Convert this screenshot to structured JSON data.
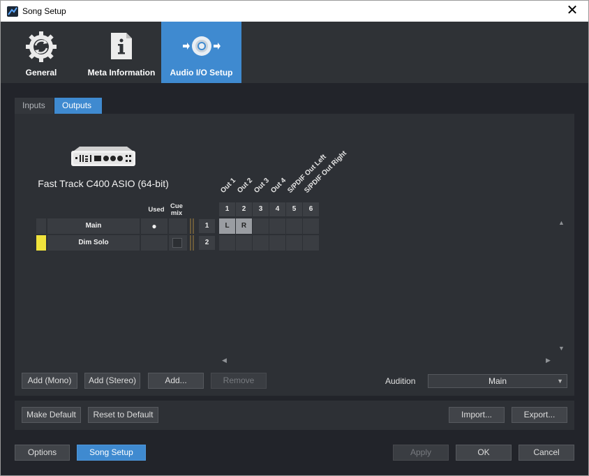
{
  "window": {
    "title": "Song Setup",
    "close_glyph": "✕"
  },
  "top_tabs": [
    {
      "label": "General",
      "icon": "gear-refresh-icon",
      "active": false
    },
    {
      "label": "Meta Information",
      "icon": "info-document-icon",
      "active": false
    },
    {
      "label": "Audio I/O Setup",
      "icon": "speaker-io-icon",
      "active": true
    }
  ],
  "sub_tabs": [
    {
      "label": "Inputs",
      "active": false
    },
    {
      "label": "Outputs",
      "active": true
    }
  ],
  "device": {
    "name": "Fast Track C400 ASIO (64-bit)"
  },
  "columns": {
    "used": "Used",
    "cue_mix": "Cue mix"
  },
  "channel_labels": [
    "Out 1",
    "Out 2",
    "Out 3",
    "Out 4",
    "S/PDIF Out Left",
    "S/PDIF Out Right"
  ],
  "channel_numbers": [
    "1",
    "2",
    "3",
    "4",
    "5",
    "6"
  ],
  "rows": [
    {
      "color": "#393c41",
      "name": "Main",
      "used": "●",
      "number": "1",
      "assign": [
        "L",
        "R",
        "",
        "",
        "",
        ""
      ]
    },
    {
      "color": "#f0e33c",
      "name": "Dim Solo",
      "used": "",
      "number": "2",
      "assign": [
        "",
        "",
        "",
        "",
        "",
        ""
      ]
    }
  ],
  "buttons": {
    "add_mono": "Add (Mono)",
    "add_stereo": "Add (Stereo)",
    "add": "Add...",
    "remove": "Remove",
    "make_default": "Make Default",
    "reset_default": "Reset to Default",
    "import": "Import...",
    "export": "Export...",
    "options": "Options",
    "song_setup": "Song Setup",
    "apply": "Apply",
    "ok": "OK",
    "cancel": "Cancel"
  },
  "audition": {
    "label": "Audition",
    "value": "Main"
  },
  "colors": {
    "accent": "#3f8ad0",
    "dim_solo": "#f0e33c"
  }
}
